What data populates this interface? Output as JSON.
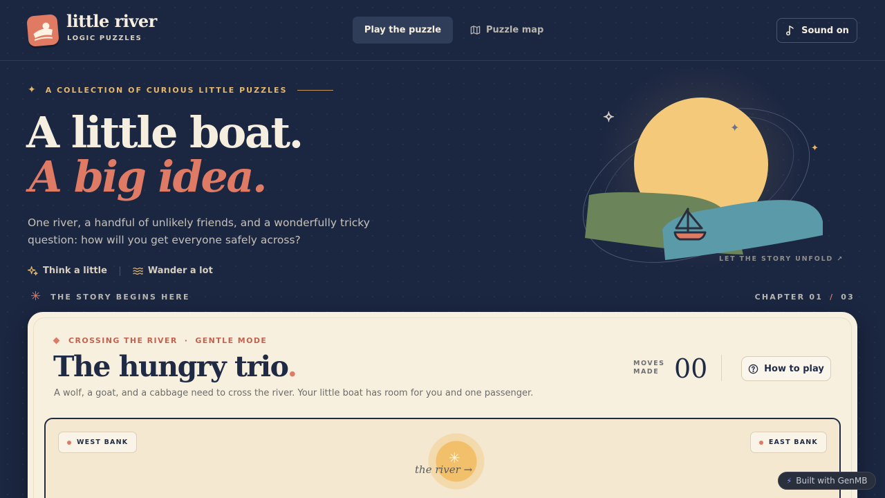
{
  "header": {
    "brand_name": "little river",
    "brand_sub": "LOGIC PUZZLES",
    "nav_play": "Play the puzzle",
    "nav_map": "Puzzle map",
    "sound": "Sound on"
  },
  "hero": {
    "eyebrow": "A COLLECTION OF CURIOUS LITTLE PUZZLES",
    "line1": "A little boat.",
    "line2": "A big idea.",
    "description": "One river, a handful of unlikely friends, and a wonderfully tricky question: how will you get everyone safely across?",
    "perk1": "Think a little",
    "perk2": "Wander a lot",
    "unfold": "LET THE STORY UNFOLD ↗"
  },
  "story": {
    "begins": "THE STORY BEGINS HERE",
    "chapter_current": "CHAPTER 01",
    "chapter_sep": "/",
    "chapter_total": "03"
  },
  "puzzle": {
    "category": "CROSSING THE RIVER",
    "separator": "·",
    "mode": "GENTLE MODE",
    "title": "The hungry trio",
    "title_dot": ".",
    "description": "A wolf, a goat, and a cabbage need to cross the river. Your little boat has room for you and one passenger.",
    "moves_label_1": "MOVES",
    "moves_label_2": "MADE",
    "moves_value": "00",
    "how_to_play": "How to play"
  },
  "board": {
    "west_bank": "WEST BANK",
    "east_bank": "EAST BANK",
    "river_label": "the river →"
  },
  "badge": {
    "built_with": "Built with GenMB"
  },
  "colors": {
    "background": "#1b2641",
    "accent_coral": "#df7a64",
    "accent_gold": "#e8b86a",
    "card": "#f8f0df",
    "ink": "#1f2a44"
  },
  "icons": [
    "boat-logo-icon",
    "map-icon",
    "music-note-icon",
    "sparkle-icon",
    "waves-icon",
    "asterisk-icon",
    "help-circle-icon",
    "bolt-icon",
    "sailboat-icon"
  ]
}
